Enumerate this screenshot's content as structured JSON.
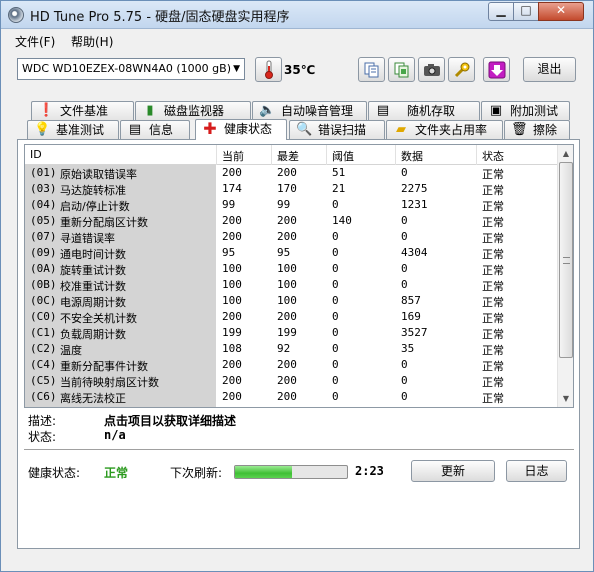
{
  "window": {
    "title": "HD Tune Pro 5.75 - 硬盘/固态硬盘实用程序"
  },
  "menu": {
    "items": [
      "文件(F)",
      "帮助(H)"
    ]
  },
  "toolbar": {
    "drive": "WDC WD10EZEX-08WN4A0 (1000 gB)",
    "temperature": "35℃",
    "exit_label": "退出"
  },
  "tabs": {
    "row1": [
      "文件基准",
      "磁盘监视器",
      "自动噪音管理",
      "随机存取",
      "附加测试"
    ],
    "row2": [
      "基准测试",
      "信息",
      "健康状态",
      "错误扫描",
      "文件夹占用率",
      "擦除"
    ],
    "active": "健康状态"
  },
  "table": {
    "headers": [
      "ID",
      "当前",
      "最差",
      "阈值",
      "数据",
      "状态"
    ],
    "rows": [
      {
        "id": "(01)",
        "name": "原始读取错误率",
        "current": "200",
        "worst": "200",
        "threshold": "51",
        "data": "0",
        "status": "正常"
      },
      {
        "id": "(03)",
        "name": "马达旋转标准",
        "current": "174",
        "worst": "170",
        "threshold": "21",
        "data": "2275",
        "status": "正常"
      },
      {
        "id": "(04)",
        "name": "启动/停止计数",
        "current": "99",
        "worst": "99",
        "threshold": "0",
        "data": "1231",
        "status": "正常"
      },
      {
        "id": "(05)",
        "name": "重新分配扇区计数",
        "current": "200",
        "worst": "200",
        "threshold": "140",
        "data": "0",
        "status": "正常"
      },
      {
        "id": "(07)",
        "name": "寻道错误率",
        "current": "200",
        "worst": "200",
        "threshold": "0",
        "data": "0",
        "status": "正常"
      },
      {
        "id": "(09)",
        "name": "通电时间计数",
        "current": "95",
        "worst": "95",
        "threshold": "0",
        "data": "4304",
        "status": "正常"
      },
      {
        "id": "(0A)",
        "name": "旋转重试计数",
        "current": "100",
        "worst": "100",
        "threshold": "0",
        "data": "0",
        "status": "正常"
      },
      {
        "id": "(0B)",
        "name": "校准重试计数",
        "current": "100",
        "worst": "100",
        "threshold": "0",
        "data": "0",
        "status": "正常"
      },
      {
        "id": "(0C)",
        "name": "电源周期计数",
        "current": "100",
        "worst": "100",
        "threshold": "0",
        "data": "857",
        "status": "正常"
      },
      {
        "id": "(C0)",
        "name": "不安全关机计数",
        "current": "200",
        "worst": "200",
        "threshold": "0",
        "data": "169",
        "status": "正常"
      },
      {
        "id": "(C1)",
        "name": "负载周期计数",
        "current": "199",
        "worst": "199",
        "threshold": "0",
        "data": "3527",
        "status": "正常"
      },
      {
        "id": "(C2)",
        "name": "温度",
        "current": "108",
        "worst": "92",
        "threshold": "0",
        "data": "35",
        "status": "正常"
      },
      {
        "id": "(C4)",
        "name": "重新分配事件计数",
        "current": "200",
        "worst": "200",
        "threshold": "0",
        "data": "0",
        "status": "正常"
      },
      {
        "id": "(C5)",
        "name": "当前待映射扇区计数",
        "current": "200",
        "worst": "200",
        "threshold": "0",
        "data": "0",
        "status": "正常"
      },
      {
        "id": "(C6)",
        "name": "离线无法校正",
        "current": "200",
        "worst": "200",
        "threshold": "0",
        "data": "0",
        "status": "正常"
      }
    ]
  },
  "description": {
    "desc_label": "描述:",
    "desc_value": "点击项目以获取详细描述",
    "status_label": "状态:",
    "status_value": "n/a"
  },
  "footer": {
    "health_label": "健康状态:",
    "health_value": "正常",
    "refresh_label": "下次刷新:",
    "refresh_fraction": 0.51,
    "countdown": "2:23",
    "update_label": "更新",
    "log_label": "日志"
  },
  "colors": {
    "ok_green": "#2b9a1e",
    "grey_column": "#d4d4d4"
  }
}
